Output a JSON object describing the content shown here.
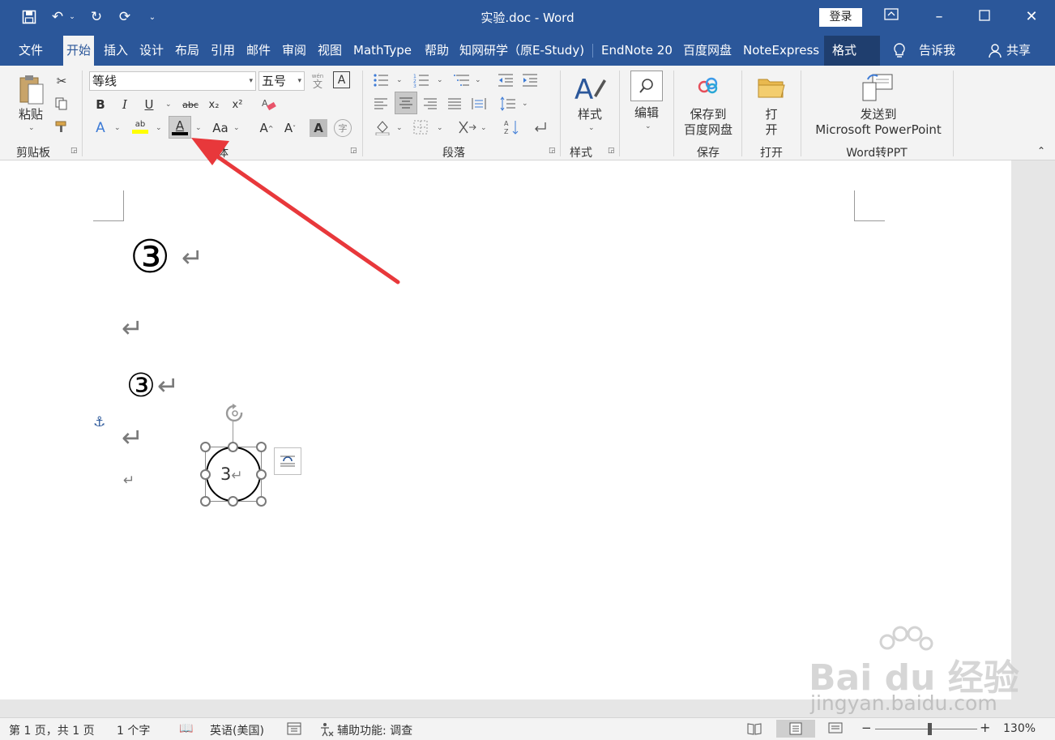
{
  "titlebar": {
    "title": "实验.doc  -  Word",
    "login_label": "登录"
  },
  "tabs": [
    "文件",
    "开始",
    "插入",
    "设计",
    "布局",
    "引用",
    "邮件",
    "审阅",
    "视图",
    "MathType",
    "帮助",
    "知网研学（原E-Study)",
    "EndNote 20",
    "百度网盘",
    "NoteExpress",
    "格式",
    "告诉我",
    "共享"
  ],
  "ribbon": {
    "clipboard": {
      "paste_label": "粘贴",
      "group_label": "剪贴板"
    },
    "font": {
      "font_name": "等线",
      "font_size": "五号",
      "group_label": "字体",
      "wen_glyph": "wén",
      "wen_char": "文",
      "bold": "B",
      "italic": "I",
      "underline": "U",
      "strike": "abc",
      "sub": "x₂",
      "sup": "x²",
      "font_color_glyph": "A",
      "case_label": "Aa",
      "grow_glyph": "A",
      "shrink_glyph": "A",
      "char_shade_glyph": "A",
      "enclose_glyph": "字",
      "highlight_color": "#ffff00",
      "font_color": "#000000"
    },
    "paragraph": {
      "group_label": "段落"
    },
    "styles": {
      "label": "样式",
      "group_label": "样式"
    },
    "editing": {
      "label": "编辑"
    },
    "save": {
      "line1": "保存到",
      "line2": "百度网盘",
      "group_label": "保存"
    },
    "open": {
      "line1": "打",
      "line2": "开",
      "group_label": "打开"
    },
    "w2ppt": {
      "line1": "发送到",
      "line2": "Microsoft PowerPoint",
      "group_label": "Word转PPT"
    }
  },
  "document": {
    "enclosed_large": "③",
    "enclosed_small": "③",
    "shape_text": "3",
    "para_mark": "↵"
  },
  "statusbar": {
    "page": "第 1 页，共 1 页",
    "words": "1 个字",
    "language": "英语(美国)",
    "accessibility": "辅助功能: 调查",
    "zoom": "130%"
  },
  "watermark": {
    "brand": "Bai  du 经验",
    "url": "jingyan.baidu.com"
  },
  "colors": {
    "accent": "#2b579a",
    "arrow": "#e8383b"
  }
}
